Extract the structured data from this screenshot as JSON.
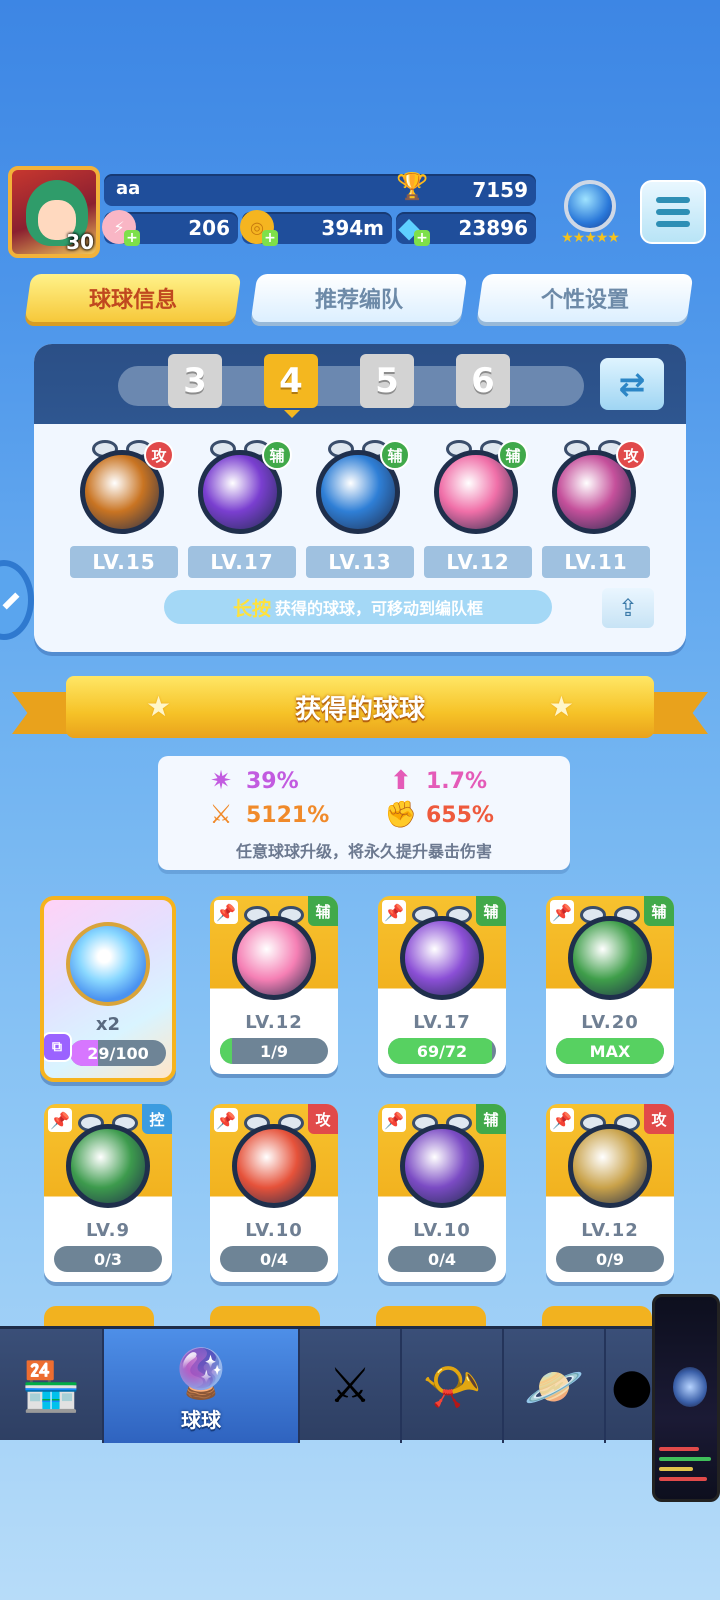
{
  "player": {
    "name": "aa",
    "level": "30",
    "trophies": "7159",
    "energy": "206",
    "distance": "394m",
    "gems": "23896",
    "rank_stars": "★★★★★"
  },
  "tabs": [
    {
      "label": "球球信息",
      "active": true
    },
    {
      "label": "推荐编队",
      "active": false
    },
    {
      "label": "个性设置",
      "active": false
    }
  ],
  "team": {
    "slots": [
      "3",
      "4",
      "5",
      "6"
    ],
    "selected_slot": "4",
    "balls": [
      {
        "tag": "攻",
        "level": "LV.15",
        "icon": "infinity-ball-icon",
        "color": "#c97422"
      },
      {
        "tag": "辅",
        "level": "LV.17",
        "icon": "lightning-ball-icon",
        "color": "#7a3fd0"
      },
      {
        "tag": "辅",
        "level": "LV.13",
        "icon": "hexshield-ball-icon",
        "color": "#2f7fd6"
      },
      {
        "tag": "辅",
        "level": "LV.12",
        "icon": "flower-ball-icon",
        "color": "#f06fa8"
      },
      {
        "tag": "攻",
        "level": "LV.11",
        "icon": "cloud-ball-icon",
        "color": "#c5509b"
      }
    ],
    "hint_highlight": "长按",
    "hint_text": "获得的球球，可移动到编队框"
  },
  "section_title": "获得的球球",
  "stats": {
    "items": [
      {
        "icon": "crit-rate-icon",
        "value": "39%",
        "color": "#c25be0"
      },
      {
        "icon": "crit-up-icon",
        "value": "1.7%",
        "color": "#e45bb8"
      },
      {
        "icon": "attack-icon",
        "value": "5121%",
        "color": "#f08a2a"
      },
      {
        "icon": "crit-damage-icon",
        "value": "655%",
        "color": "#ee5a3d"
      }
    ],
    "description": "任意球球升级，将永久提升暴击伤害"
  },
  "special_card": {
    "multiplier": "x2",
    "progress_text": "29/100",
    "progress": 0.29
  },
  "cards": [
    {
      "tag": "辅",
      "tag_class": "sup",
      "level": "LV.12",
      "progress_text": "1/9",
      "progress": 0.11,
      "icon": "flower-ball-icon",
      "color": "#f57fb4"
    },
    {
      "tag": "辅",
      "tag_class": "sup",
      "level": "LV.17",
      "progress_text": "69/72",
      "progress": 0.96,
      "icon": "leaf-ball-icon",
      "color": "#8b4fd6"
    },
    {
      "tag": "辅",
      "tag_class": "sup",
      "level": "LV.20",
      "progress_text": "MAX",
      "progress": 1.0,
      "icon": "arrow-ball-icon",
      "color": "#3f9e4a"
    },
    {
      "tag": "控",
      "tag_class": "ctl",
      "level": "LV.9",
      "progress_text": "0/3",
      "progress": 0.0,
      "icon": "monkey-ball-icon",
      "color": "#3d9b4d"
    },
    {
      "tag": "攻",
      "tag_class": "atk",
      "level": "LV.10",
      "progress_text": "0/4",
      "progress": 0.0,
      "icon": "fox-ball-icon",
      "color": "#e6523a"
    },
    {
      "tag": "辅",
      "tag_class": "sup",
      "level": "LV.10",
      "progress_text": "0/4",
      "progress": 0.0,
      "icon": "girl-ball-icon",
      "color": "#7b4bc4"
    },
    {
      "tag": "攻",
      "tag_class": "atk",
      "level": "LV.12",
      "progress_text": "0/9",
      "progress": 0.0,
      "icon": "elder-ball-icon",
      "color": "#c9a24a"
    }
  ],
  "nav": [
    {
      "icon": "shop-icon",
      "label": "",
      "active": false
    },
    {
      "icon": "balls-icon",
      "label": "球球",
      "active": true
    },
    {
      "icon": "battle-icon",
      "label": "",
      "active": false
    },
    {
      "icon": "whistle-icon",
      "label": "",
      "active": false
    },
    {
      "icon": "planet-icon",
      "label": "",
      "active": false
    },
    {
      "icon": "more-icon",
      "label": "",
      "active": false
    }
  ]
}
